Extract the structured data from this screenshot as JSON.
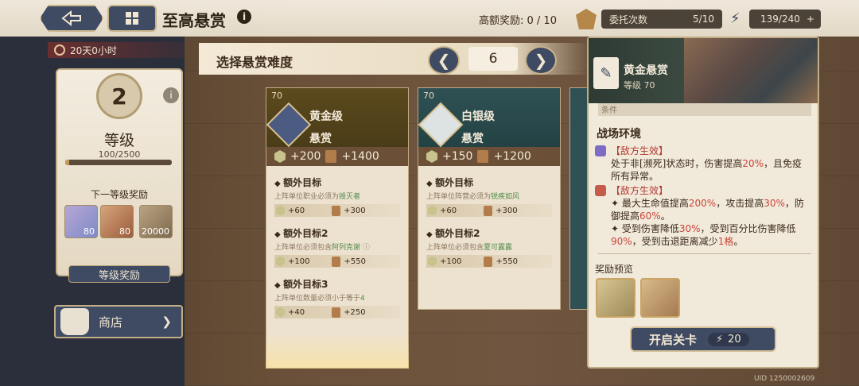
{
  "header": {
    "title": "至高悬赏",
    "reward_label": "高额奖励: 0 / 10",
    "commission_label": "委托次数",
    "commission_value": "5/10",
    "stamina": "139/240",
    "stamina_plus": "+"
  },
  "timer": "20天0小时",
  "level_card": {
    "level": "2",
    "label": "等级",
    "progress_text": "100/2500",
    "progress": 0.04,
    "next_label": "下一等级奖励",
    "rewards": [
      {
        "name": "star-crystal",
        "count": "80"
      },
      {
        "name": "card-ticket",
        "count": "80"
      },
      {
        "name": "gold-coin",
        "count": "20000"
      }
    ],
    "button": "等级奖励"
  },
  "shop": {
    "label": "商店"
  },
  "difficulty": {
    "label": "选择悬赏难度",
    "value": "6"
  },
  "cards": [
    {
      "tag": "70",
      "name_line1": "黄金级",
      "name_line2": "悬赏",
      "gem": "+200",
      "scroll": "+1400",
      "objectives": [
        {
          "title": "额外目标",
          "desc_prefix": "上阵单位职业必须为",
          "desc_hl": "毁灭者",
          "gem": "+60",
          "scroll": "+300"
        },
        {
          "title": "额外目标2",
          "desc_prefix": "上阵单位必须包含",
          "desc_hl": "阿列克谢",
          "gem": "+100",
          "scroll": "+550"
        },
        {
          "title": "额外目标3",
          "desc_prefix": "上阵单位数量必须小于等于",
          "desc_hl": "4",
          "gem": "+40",
          "scroll": "+250"
        }
      ]
    },
    {
      "tag": "70",
      "name_line1": "白银级",
      "name_line2": "悬赏",
      "gem": "+150",
      "scroll": "+1200",
      "objectives": [
        {
          "title": "额外目标",
          "desc_prefix": "上阵单位阵营必须为",
          "desc_hl": "锐疾如风",
          "gem": "+60",
          "scroll": "+300"
        },
        {
          "title": "额外目标2",
          "desc_prefix": "上阵单位必须包含",
          "desc_hl": "夏可露露",
          "gem": "+100",
          "scroll": "+550"
        }
      ]
    }
  ],
  "detail": {
    "name": "黄金悬赏",
    "level": "等级 70",
    "strip": "条件",
    "env_title": "战场环境",
    "effect1": {
      "head": "【敌方生效】",
      "text_a": "处于非[濒死]状态时，伤害提高",
      "red_a": "20%",
      "text_b": "，且免疫所有异常。"
    },
    "effect2": {
      "head": "【敌方生效】",
      "line1_a": "✦ 最大生命值提高",
      "line1_r1": "200%",
      "line1_b": "，攻击提高",
      "line1_r2": "30%",
      "line1_c": "，防御提高",
      "line1_r3": "60%",
      "line1_d": "。",
      "line2_a": "✦ 受到伤害降低",
      "line2_r1": "30%",
      "line2_b": "，受到百分比伤害降低",
      "line2_r2": "90%",
      "line2_c": "，受到击退距离减少",
      "line2_r3": "1格",
      "line2_d": "。"
    },
    "reward_label": "奖励预览",
    "start_button": "开启关卡",
    "start_cost": "20"
  },
  "uid": "UID 1250002609",
  "colors": {
    "panel_navy": "#3f4a63",
    "gold_card": "#4a3c18",
    "silver_card": "#244244",
    "highlight_red": "#c9453a",
    "highlight_green": "#4e8a4a"
  }
}
